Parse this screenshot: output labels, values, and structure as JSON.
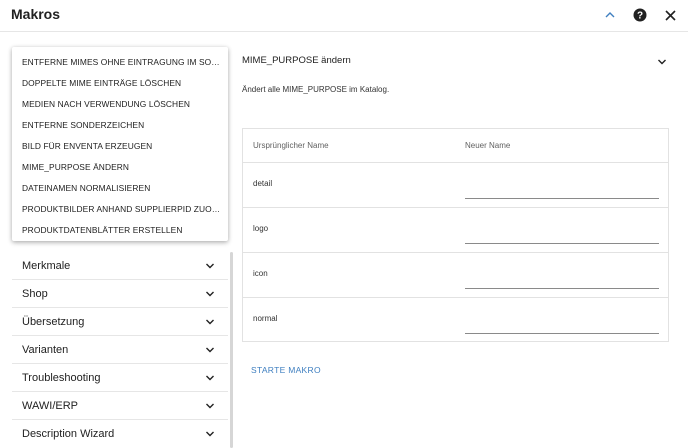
{
  "header": {
    "title": "Makros"
  },
  "menu": {
    "items": [
      "ENTFERNE MIMES OHNE EINTRAGUNG IM SOU...",
      "DOPPELTE MIME EINTRÄGE LÖSCHEN",
      "MEDIEN NACH VERWENDUNG LÖSCHEN",
      "ENTFERNE SONDERZEICHEN",
      "BILD FÜR ENVENTA ERZEUGEN",
      "MIME_PURPOSE ÄNDERN",
      "DATEINAMEN NORMALISIEREN",
      "PRODUKTBILDER ANHAND SUPPLIERPID ZUOR...",
      "PRODUKTDATENBLÄTTER ERSTELLEN"
    ]
  },
  "accordion": {
    "items": [
      "Merkmale",
      "Shop",
      "Übersetzung",
      "Varianten",
      "Troubleshooting",
      "WAWI/ERP",
      "Description Wizard"
    ]
  },
  "panel": {
    "title": "MIME_PURPOSE ändern",
    "description": "Ändert alle MIME_PURPOSE im Katalog."
  },
  "table": {
    "col_original": "Ursprünglicher Name",
    "col_new": "Neuer Name",
    "rows": [
      {
        "original": "detail",
        "new": ""
      },
      {
        "original": "logo",
        "new": ""
      },
      {
        "original": "icon",
        "new": ""
      },
      {
        "original": "normal",
        "new": ""
      }
    ]
  },
  "start_button": "STARTE MAKRO",
  "colors": {
    "accent": "#3f7fc0",
    "text": "#212121",
    "divider": "#e2e2e2"
  }
}
